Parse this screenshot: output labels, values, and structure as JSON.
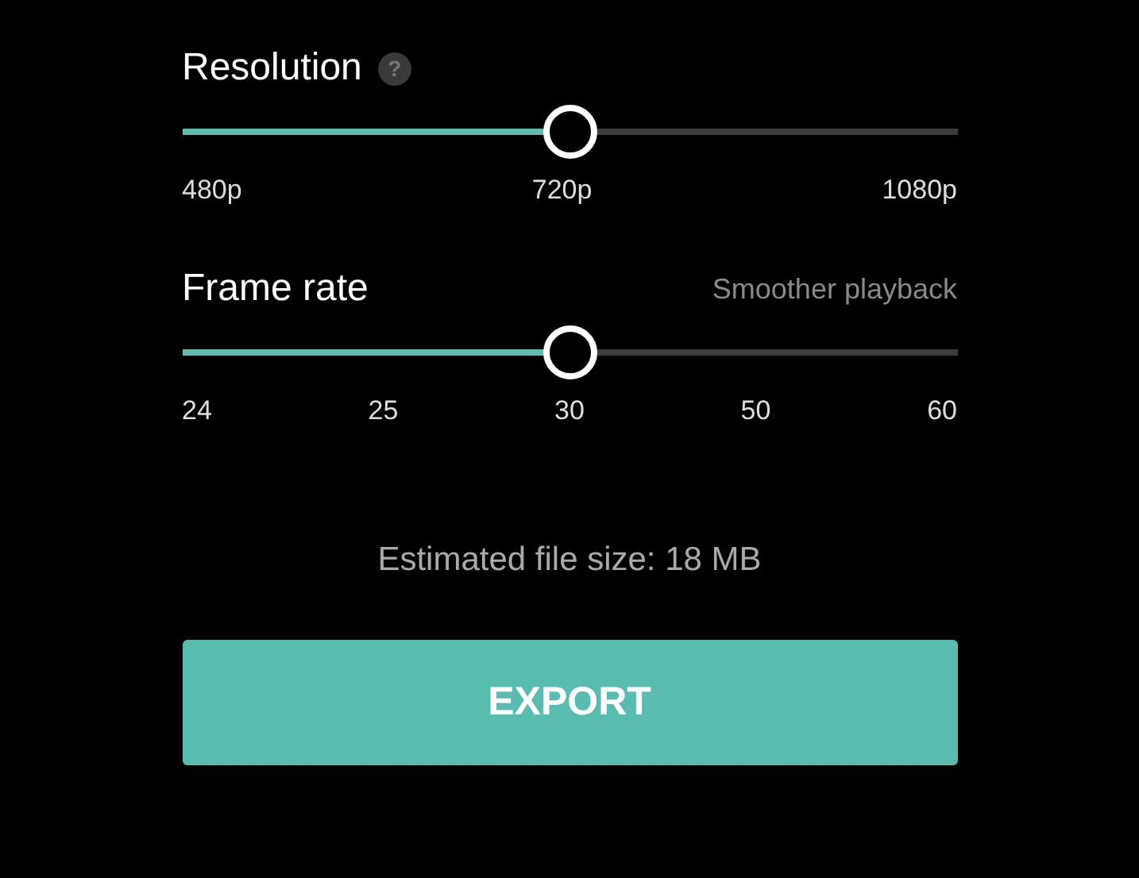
{
  "sliders": [
    {
      "title": "Resolution",
      "help": "?",
      "level": 0.5,
      "labels": [
        "480p",
        "720p",
        "1080p"
      ]
    },
    {
      "title": "Frame rate",
      "hint": "Smoother playback",
      "level": 0.5,
      "labels": [
        "24",
        "25",
        "30",
        "50",
        "60"
      ]
    }
  ],
  "estimate": "Estimated file size: 18 MB",
  "button": "EXPORT"
}
